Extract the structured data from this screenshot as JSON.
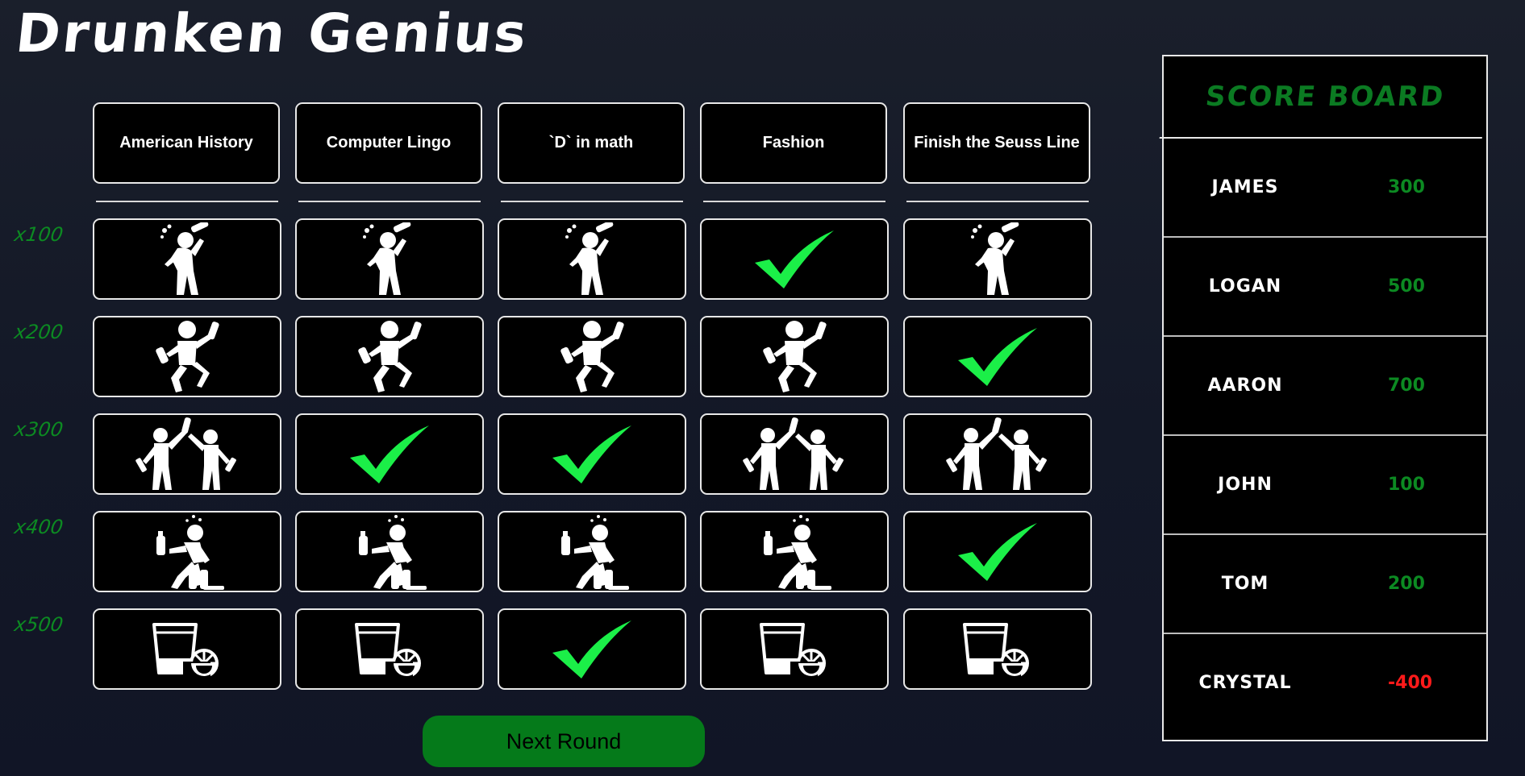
{
  "title": "Drunken Genius",
  "categories": [
    "American History",
    "Computer Lingo",
    "`D` in math",
    "Fashion",
    "Finish the Seuss Line"
  ],
  "point_labels": [
    "x100",
    "x200",
    "x300",
    "x400",
    "x500"
  ],
  "tile_rows": [
    {
      "value": "x100",
      "icon": "drinking-person-icon",
      "answered": [
        false,
        false,
        false,
        true,
        false
      ]
    },
    {
      "value": "x200",
      "icon": "dancing-person-icon",
      "answered": [
        false,
        false,
        false,
        false,
        true
      ]
    },
    {
      "value": "x300",
      "icon": "two-people-cheers-icon",
      "answered": [
        false,
        true,
        true,
        false,
        false
      ]
    },
    {
      "value": "x400",
      "icon": "falling-drunk-person-icon",
      "answered": [
        false,
        false,
        false,
        false,
        true
      ]
    },
    {
      "value": "x500",
      "icon": "shot-glass-lime-icon",
      "answered": [
        false,
        false,
        true,
        false,
        false
      ]
    }
  ],
  "answered_icon": "green-checkmark-icon",
  "next_round_label": "Next Round",
  "scoreboard": {
    "title": "Score Board",
    "players": [
      {
        "name": "James",
        "score": "300"
      },
      {
        "name": "Logan",
        "score": "500"
      },
      {
        "name": "Aaron",
        "score": "700"
      },
      {
        "name": "John",
        "score": "100"
      },
      {
        "name": "Tom",
        "score": "200"
      },
      {
        "name": "Crystal",
        "score": "-400"
      }
    ]
  },
  "colors": {
    "background": "#151a28",
    "accent_green": "#0c8a22",
    "check_green": "#1bef48",
    "negative_red": "#ff1a1a",
    "button_green": "#057a1a"
  }
}
